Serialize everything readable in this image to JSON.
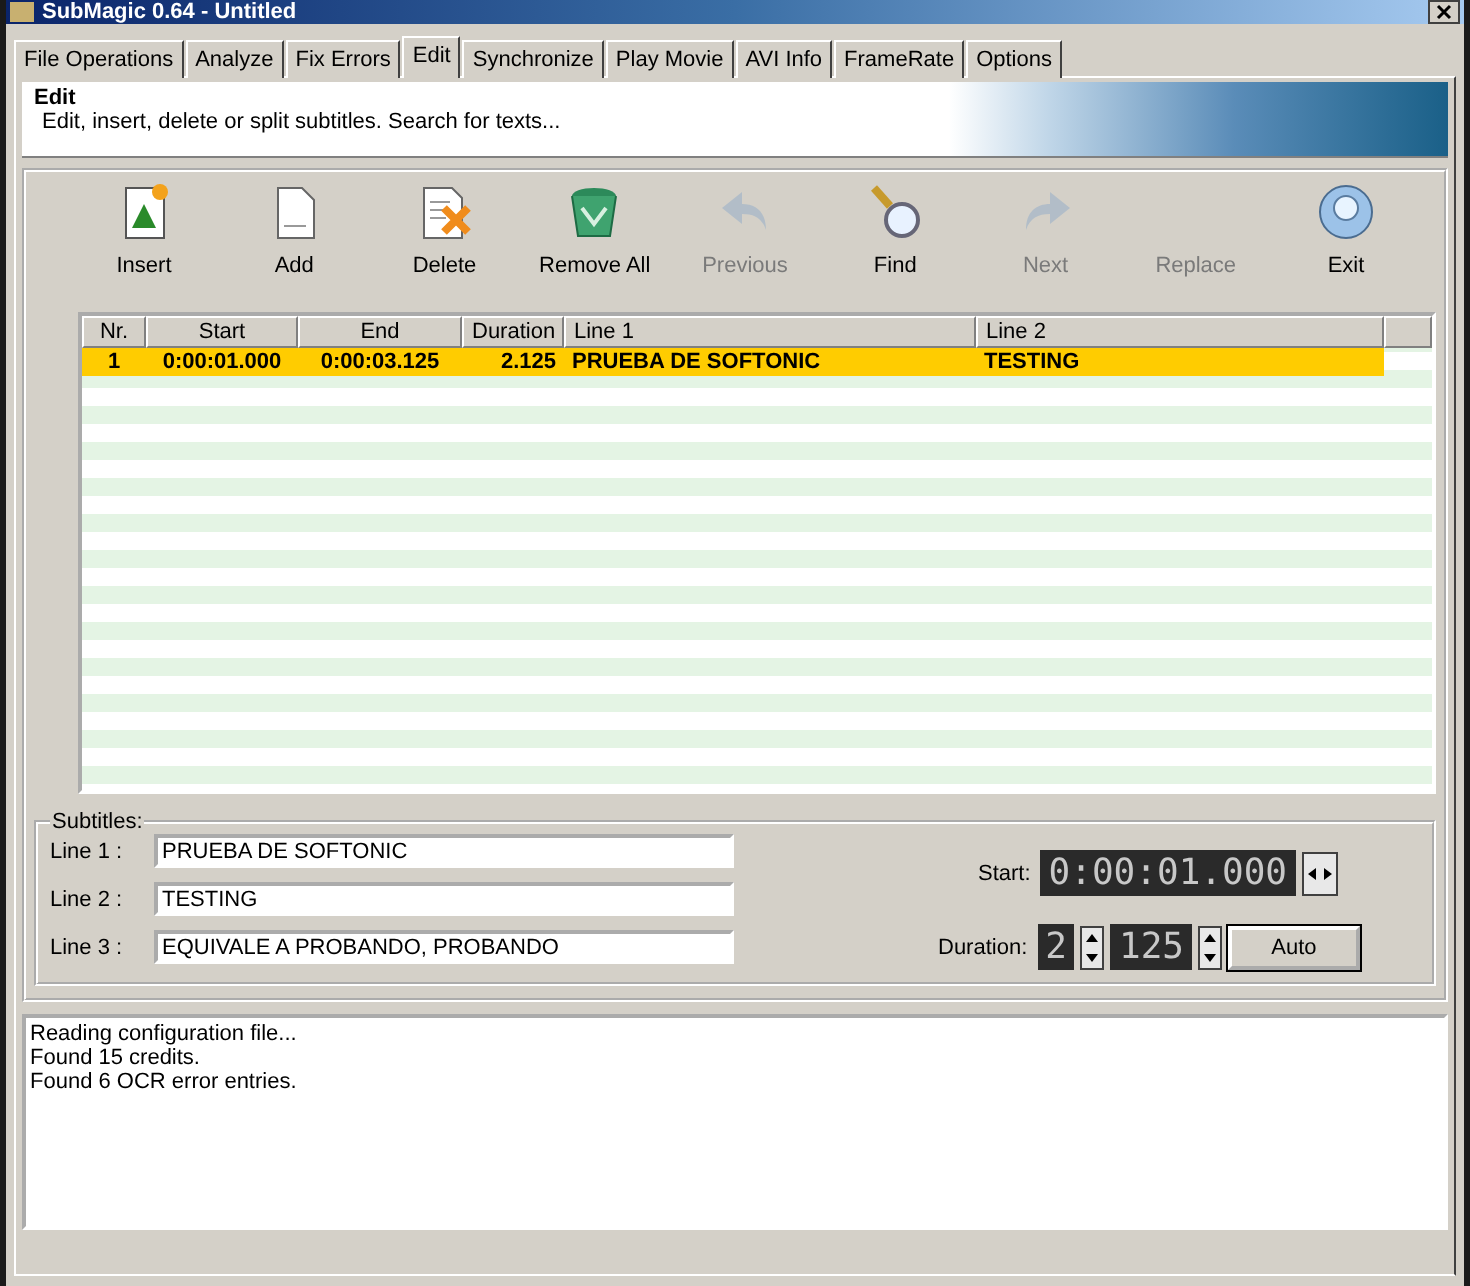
{
  "window": {
    "title": "SubMagic 0.64 - Untitled"
  },
  "tabs": [
    {
      "label": "File Operations",
      "selected": false
    },
    {
      "label": "Analyze",
      "selected": false
    },
    {
      "label": "Fix Errors",
      "selected": false
    },
    {
      "label": "Edit",
      "selected": true
    },
    {
      "label": "Synchronize",
      "selected": false
    },
    {
      "label": "Play Movie",
      "selected": false
    },
    {
      "label": "AVI Info",
      "selected": false
    },
    {
      "label": "FrameRate",
      "selected": false
    },
    {
      "label": "Options",
      "selected": false
    }
  ],
  "header": {
    "title": "Edit",
    "description": "Edit, insert, delete or split subtitles. Search for texts..."
  },
  "toolbar": [
    {
      "kind": "insert",
      "label": "Insert",
      "disabled": false
    },
    {
      "kind": "add",
      "label": "Add",
      "disabled": false
    },
    {
      "kind": "delete",
      "label": "Delete",
      "disabled": false
    },
    {
      "kind": "removeall",
      "label": "Remove All",
      "disabled": false
    },
    {
      "kind": "previous",
      "label": "Previous",
      "disabled": true
    },
    {
      "kind": "find",
      "label": "Find",
      "disabled": false
    },
    {
      "kind": "next",
      "label": "Next",
      "disabled": true
    },
    {
      "kind": "replace",
      "label": "Replace",
      "disabled": true
    },
    {
      "kind": "exit",
      "label": "Exit",
      "disabled": false
    }
  ],
  "table": {
    "columns": [
      "Nr.",
      "Start",
      "End",
      "Duration",
      "Line 1",
      "Line 2"
    ],
    "rows": [
      {
        "cells": [
          "1",
          "0:00:01.000",
          "0:00:03.125",
          "2.125",
          "PRUEBA DE SOFTONIC",
          "TESTING"
        ],
        "selected": true
      }
    ]
  },
  "subtitles": {
    "title": "Subtitles:",
    "lines": [
      {
        "label": "Line 1 :",
        "value": "PRUEBA DE SOFTONIC"
      },
      {
        "label": "Line 2 :",
        "value": "TESTING"
      },
      {
        "label": "Line 3 :",
        "value": "EQUIVALE A PROBANDO, PROBANDO"
      }
    ],
    "start_label": "Start:",
    "start_value": "0:00:01.000",
    "duration_label": "Duration:",
    "duration_seconds": "2",
    "duration_millis": "125",
    "auto_button": "Auto"
  },
  "log": [
    "Reading configuration file...",
    "Found 15 credits.",
    "Found 6 OCR error entries."
  ]
}
